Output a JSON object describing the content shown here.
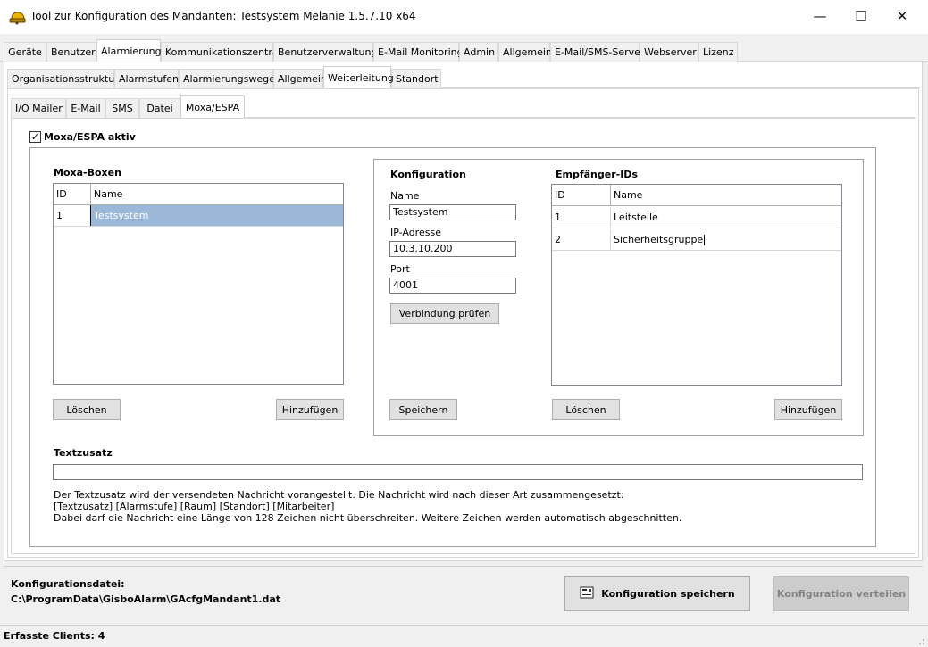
{
  "window": {
    "title": "Tool zur Konfiguration des Mandanten: Testsystem Melanie 1.5.7.10 x64",
    "minimize": "—",
    "maximize": "☐",
    "close": "✕"
  },
  "main_tabs": [
    "Geräte",
    "Benutzer",
    "Alarmierung",
    "Kommunikationszentrale",
    "Benutzerverwaltung",
    "E-Mail Monitoring",
    "Admin",
    "Allgemein",
    "E-Mail/SMS-Server",
    "Webserver",
    "Lizenz"
  ],
  "sub_tabs": [
    "Organisationsstruktur",
    "Alarmstufen",
    "Alarmierungswege",
    "Allgemein",
    "Weiterleitung",
    "Standort"
  ],
  "third_tabs": [
    "I/O Mailer",
    "E-Mail",
    "SMS",
    "Datei",
    "Moxa/ESPA"
  ],
  "active": {
    "main": "Alarmierung",
    "sub": "Weiterleitung",
    "third": "Moxa/ESPA"
  },
  "moxa": {
    "active_label": "Moxa/ESPA aktiv",
    "active_checked": "✓",
    "boxes": {
      "title": "Moxa-Boxen",
      "columns": [
        "ID",
        "Name"
      ],
      "rows": [
        {
          "id": "1",
          "name": "Testsystem"
        }
      ],
      "delete_label": "Löschen",
      "add_label": "Hinzufügen"
    },
    "config": {
      "title": "Konfiguration",
      "name_label": "Name",
      "name_value": "Testsystem",
      "ip_label": "IP-Adresse",
      "ip_value": "10.3.10.200",
      "port_label": "Port",
      "port_value": "4001",
      "check_label": "Verbindung prüfen",
      "save_label": "Speichern"
    },
    "recipients": {
      "title": "Empfänger-IDs",
      "columns": [
        "ID",
        "Name"
      ],
      "rows": [
        {
          "id": "1",
          "name": "Leitstelle"
        },
        {
          "id": "2",
          "name": "Sicherheitsgruppe"
        }
      ],
      "delete_label": "Löschen",
      "add_label": "Hinzufügen"
    },
    "textzusatz": {
      "title": "Textzusatz",
      "value": "",
      "info_line1": "Der Textzusatz wird der versendeten Nachricht vorangestellt. Die Nachricht wird nach dieser Art zusammengesetzt:",
      "info_line2": "[Textzusatz] [Alarmstufe] [Raum] [Standort] [Mitarbeiter]",
      "info_line3": "Dabei darf die Nachricht eine Länge von 128 Zeichen nicht überschreiten. Weitere Zeichen werden automatisch abgeschnitten."
    }
  },
  "footer": {
    "config_file_label": "Konfigurationsdatei:",
    "config_file_path": "C:\\ProgramData\\GisboAlarm\\GAcfgMandant1.dat",
    "save_config_label": "Konfiguration speichern",
    "distribute_label": "Konfiguration verteilen"
  },
  "status": {
    "clients": "Erfasste Clients: 4"
  },
  "colors": {
    "selection": "#9bb8d8",
    "disabled_button": "#cccccc",
    "disabled_text": "#838383"
  },
  "icons": {
    "app": "alarm-bell-icon",
    "save": "save-config-icon"
  }
}
